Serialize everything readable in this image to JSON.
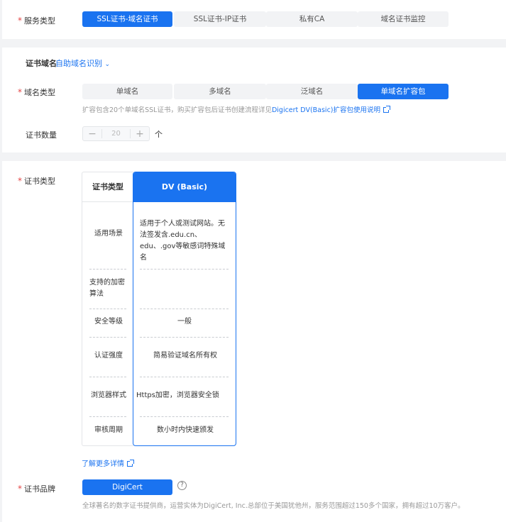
{
  "service_type": {
    "label": "服务类型",
    "options": [
      "SSL证书-域名证书",
      "SSL证书-IP证书",
      "私有CA",
      "域名证书监控"
    ],
    "selected": 0
  },
  "domain": {
    "label": "证书域名",
    "auto_detect": "自助域名识别",
    "type_label": "域名类型",
    "type_options": [
      "单域名",
      "多域名",
      "泛域名",
      "单域名扩容包"
    ],
    "type_selected": 3,
    "hint_text": "扩容包含20个单域名SSL证书，购买扩容包后证书创建流程详见",
    "hint_link": "Digicert DV(Basic)扩容包使用说明"
  },
  "quantity": {
    "label": "证书数量",
    "minus": "−",
    "value": "20",
    "plus": "+",
    "unit": "个"
  },
  "cert_type": {
    "label": "证书类型",
    "header_left": "证书类型",
    "header_right": "DV (Basic)",
    "rows": [
      {
        "name": "适用场景",
        "value": "适用于个人或测试网站。无法签发含.edu.cn、edu、.gov等敏感词特殊域名"
      },
      {
        "name": "支持的加密算法",
        "value": ""
      },
      {
        "name": "安全等级",
        "value": "一般"
      },
      {
        "name": "认证强度",
        "value": "简易验证域名所有权"
      },
      {
        "name": "浏览器样式",
        "value": "Https加密，浏览器安全锁"
      },
      {
        "name": "审核周期",
        "value": "数小时内快速颁发"
      }
    ],
    "more_link": "了解更多详情"
  },
  "brand": {
    "label": "证书品牌",
    "button": "DigiCert",
    "help": "?",
    "desc": "全球著名的数字证书提供商，运营实体为DigiCert, Inc.总部位于美国犹他州，服务范围超过150多个国家，拥有超过10万客户。"
  },
  "colors": {
    "accent": "#1a73f0",
    "required": "#e54545"
  }
}
